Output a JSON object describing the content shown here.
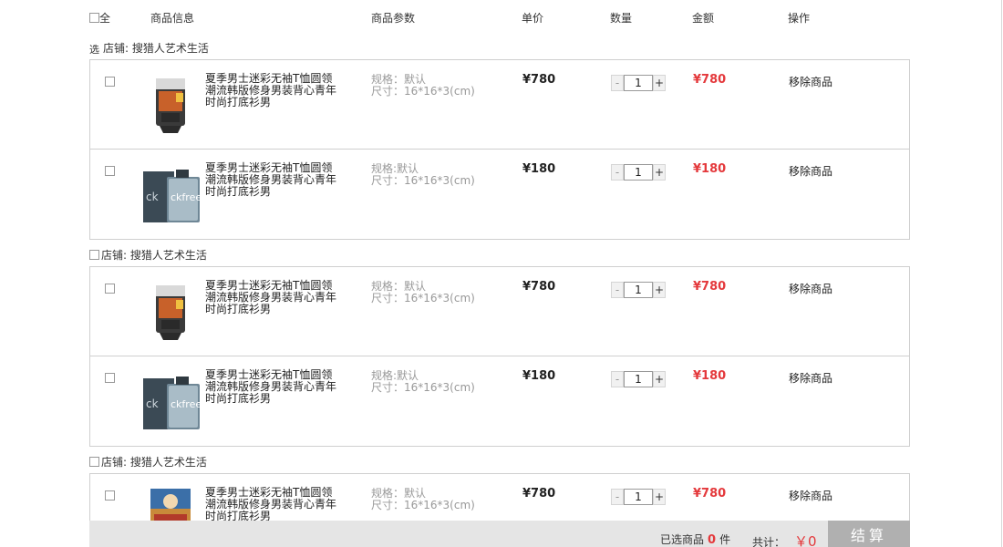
{
  "header": {
    "select_all": "全",
    "col_info": "商品信息",
    "col_params": "商品参数",
    "col_price": "单价",
    "col_qty": "数量",
    "col_amount": "金额",
    "col_action": "操作"
  },
  "stores": [
    {
      "label": "店铺: 搜猎人艺术生活",
      "items": [
        {
          "title": "夏季男士迷彩无袖T恤圆领潮流韩版修身男装背心青年时尚打底衫男",
          "spec": "规格：默认",
          "size": "尺寸：16*16*3(cm)",
          "price": "¥780",
          "qty": "1",
          "amount": "¥780",
          "remove": "移除商品",
          "image": "facial-cleanser-tube"
        },
        {
          "title": "夏季男士迷彩无袖T恤圆领潮流韩版修身男装背心青年时尚打底衫男",
          "spec": "规格:默认",
          "size": "尺寸：16*16*3(cm)",
          "price": "¥180",
          "qty": "1",
          "amount": "¥180",
          "remove": "移除商品",
          "image": "ck-free-perfume"
        }
      ]
    },
    {
      "label": "店铺: 搜猎人艺术生活",
      "items": [
        {
          "title": "夏季男士迷彩无袖T恤圆领潮流韩版修身男装背心青年时尚打底衫男",
          "spec": "规格：默认",
          "size": "尺寸：16*16*3(cm)",
          "price": "¥780",
          "qty": "1",
          "amount": "¥780",
          "remove": "移除商品",
          "image": "facial-cleanser-tube"
        },
        {
          "title": "夏季男士迷彩无袖T恤圆领潮流韩版修身男装背心青年时尚打底衫男",
          "spec": "规格:默认",
          "size": "尺寸：16*16*3(cm)",
          "price": "¥180",
          "qty": "1",
          "amount": "¥180",
          "remove": "移除商品",
          "image": "ck-free-perfume"
        }
      ]
    },
    {
      "label": "店铺: 搜猎人艺术生活",
      "items": [
        {
          "title": "夏季男士迷彩无袖T恤圆领潮流韩版修身男装背心青年时尚打底衫男",
          "spec": "规格：默认",
          "size": "尺寸：16*16*3(cm)",
          "price": "¥780",
          "qty": "1",
          "amount": "¥780",
          "remove": "移除商品",
          "image": "coffee-bag"
        }
      ]
    }
  ],
  "qty_minus": "-",
  "qty_plus": "+",
  "first_store_marker": "选",
  "footer": {
    "selected_prefix": "已选商品",
    "selected_count": "0",
    "selected_suffix": "件",
    "total_label": "共计：",
    "total_value": "￥0",
    "checkout": "结算"
  },
  "colors": {
    "accent_red": "#e4393c",
    "footer_bg": "#e5e5e5",
    "checkout_bg": "#b0b0b0"
  }
}
